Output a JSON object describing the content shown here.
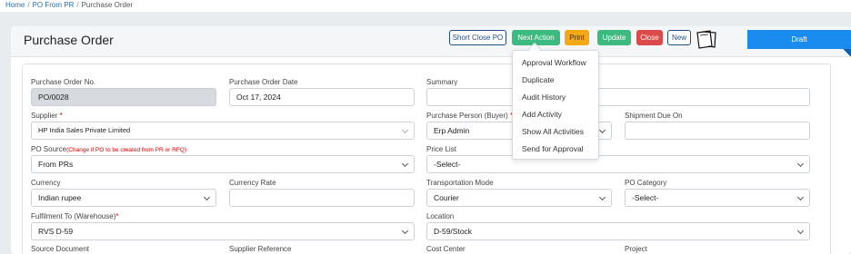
{
  "breadcrumb": {
    "home": "Home",
    "po_from_pr": "PO From PR",
    "current": "Purchase Order",
    "separator": "/"
  },
  "page": {
    "title": "Purchase Order",
    "status": "Draft"
  },
  "toolbar": {
    "short_close": "Short Close PO",
    "next_action": "Next Action",
    "print": "Print",
    "update": "Update",
    "close": "Close",
    "new": "New"
  },
  "next_action_menu": [
    "Approval Workflow",
    "Duplicate",
    "Audit History",
    "Add Activity",
    "Show All Activities",
    "Send for Approval"
  ],
  "form": {
    "po_number": {
      "label": "Purchase Order No.",
      "value": "PO/0028"
    },
    "po_date": {
      "label": "Purchase Order Date",
      "value": "Oct 17, 2024"
    },
    "summary": {
      "label": "Summary",
      "value": ""
    },
    "supplier": {
      "label": "Supplier",
      "required": "*",
      "value": "HP India Sales Private Limited"
    },
    "purchase_person": {
      "label": "Purchase Person (Buyer)",
      "required": "*",
      "value": "Erp Admin"
    },
    "shipment_due": {
      "label": "Shipment Due On",
      "value": ""
    },
    "po_source": {
      "label": "PO Source",
      "hint": "(Change if PO to be created from PR or RFQ)",
      "value": "From PRs"
    },
    "price_list": {
      "label": "Price List",
      "value": "-Select-"
    },
    "currency": {
      "label": "Currency",
      "value": "Indian rupee"
    },
    "currency_rate": {
      "label": "Currency Rate",
      "value": ""
    },
    "transport_mode": {
      "label": "Transportation Mode",
      "value": "Courier"
    },
    "po_category": {
      "label": "PO Category",
      "value": "-Select-"
    },
    "fulfilment_to": {
      "label": "Fulfilment To (Warehouse)",
      "required": "*",
      "value": "RVS D-59"
    },
    "location": {
      "label": "Location",
      "value": "D-59/Stock"
    },
    "source_document": {
      "label": "Source Document"
    },
    "supplier_reference": {
      "label": "Supplier Reference"
    },
    "cost_center": {
      "label": "Cost Center"
    },
    "project": {
      "label": "Project"
    }
  },
  "colors": {
    "accent": "#1a8cf0",
    "green": "#3cba7f",
    "yellow": "#f3a814",
    "red": "#dc4b4b",
    "outline": "#1f4e86"
  },
  "icons": [
    "chevron-down-icon",
    "document-icon"
  ]
}
